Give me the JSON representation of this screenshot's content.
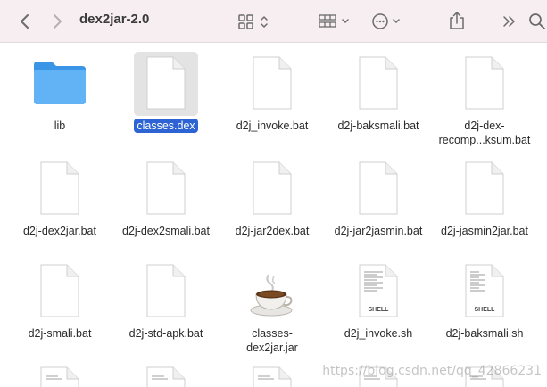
{
  "window": {
    "title": "dex2jar-2.0"
  },
  "toolbar": {
    "back_icon": "chevron-left-icon",
    "forward_icon": "chevron-right-icon",
    "view_icon": "grid-view-icon",
    "group_icon": "group-by-icon",
    "action_icon": "ellipsis-circle-icon",
    "share_icon": "share-icon",
    "more_icon": "double-chevron-right-icon",
    "search_icon": "search-icon"
  },
  "files": [
    {
      "name": "lib",
      "kind": "folder"
    },
    {
      "name": "classes.dex",
      "kind": "doc",
      "selected": true
    },
    {
      "name": "d2j_invoke.bat",
      "kind": "doc"
    },
    {
      "name": "d2j-baksmali.bat",
      "kind": "doc"
    },
    {
      "name": "d2j-dex-recomp...ksum.bat",
      "kind": "doc",
      "line1": "d2j-dex-",
      "line2": "recomp...ksum.bat"
    },
    {
      "name": "d2j-dex2jar.bat",
      "kind": "doc"
    },
    {
      "name": "d2j-dex2smali.bat",
      "kind": "doc"
    },
    {
      "name": "d2j-jar2dex.bat",
      "kind": "doc"
    },
    {
      "name": "d2j-jar2jasmin.bat",
      "kind": "doc"
    },
    {
      "name": "d2j-jasmin2jar.bat",
      "kind": "doc"
    },
    {
      "name": "d2j-smali.bat",
      "kind": "doc"
    },
    {
      "name": "d2j-std-apk.bat",
      "kind": "doc"
    },
    {
      "name": "classes-dex2jar.jar",
      "kind": "jar",
      "line1": "classes-",
      "line2": "dex2jar.jar"
    },
    {
      "name": "d2j_invoke.sh",
      "kind": "shell",
      "badge": "SHELL"
    },
    {
      "name": "d2j-baksmali.sh",
      "kind": "shell",
      "badge": "SHELL"
    }
  ],
  "watermark": "https://blog.csdn.net/qq_42866231"
}
